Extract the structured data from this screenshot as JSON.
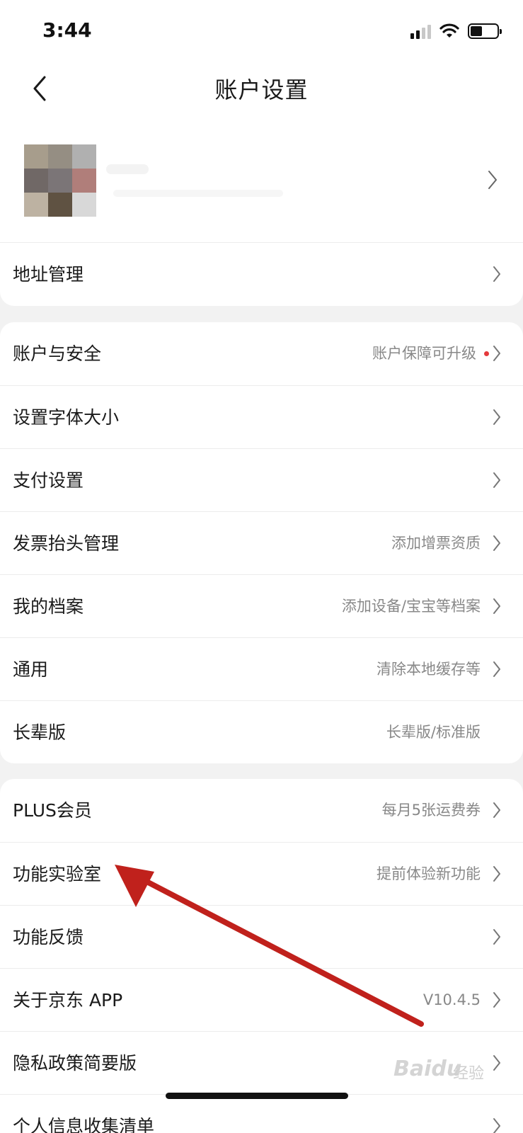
{
  "status_bar": {
    "time": "3:44",
    "icons": [
      "signal-icon",
      "wifi-icon",
      "battery-icon"
    ]
  },
  "nav": {
    "back_icon": "chevron-left-icon",
    "title": "账户设置"
  },
  "profile": {
    "avatar_colors": [
      "#a79d8c",
      "#958e83",
      "#b0b0b0",
      "#706866",
      "#7b7577",
      "#b07e7a",
      "#bdb2a2",
      "#5f5242",
      "#d8d8d8"
    ]
  },
  "sections": [
    {
      "rows": [
        {
          "label": "地址管理",
          "value": "",
          "chevron": true
        }
      ]
    },
    {
      "rows": [
        {
          "label": "账户与安全",
          "value": "账户保障可升级",
          "chevron": true,
          "dot": true
        },
        {
          "label": "设置字体大小",
          "value": "",
          "chevron": true
        },
        {
          "label": "支付设置",
          "value": "",
          "chevron": true
        },
        {
          "label": "发票抬头管理",
          "value": "添加增票资质",
          "chevron": true
        },
        {
          "label": "我的档案",
          "value": "添加设备/宝宝等档案",
          "chevron": true
        },
        {
          "label": "通用",
          "value": "清除本地缓存等",
          "chevron": true
        },
        {
          "label": "长辈版",
          "value": "长辈版/标准版",
          "chevron": false
        }
      ]
    },
    {
      "rows": [
        {
          "label": "PLUS会员",
          "value": "每月5张运费券",
          "chevron": true
        },
        {
          "label": "功能实验室",
          "value": "提前体验新功能",
          "chevron": true
        },
        {
          "label": "功能反馈",
          "value": "",
          "chevron": true
        },
        {
          "label": "关于京东 APP",
          "value": "V10.4.5",
          "chevron": true
        },
        {
          "label": "隐私政策简要版",
          "value": "",
          "chevron": true
        },
        {
          "label": "个人信息收集清单",
          "value": "",
          "chevron": true
        }
      ]
    }
  ],
  "annotation": {
    "color": "#c0211c"
  },
  "watermark": {
    "logo": "Baidu",
    "sub": "经验"
  },
  "accent_dot_color": "#e4393c"
}
